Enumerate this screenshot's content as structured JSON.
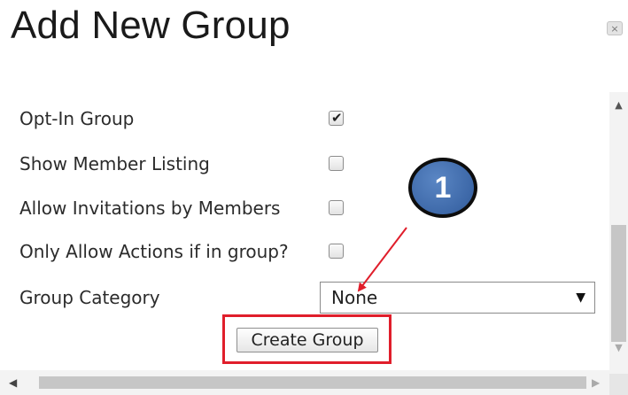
{
  "dialog": {
    "title": "Add New Group",
    "close_icon": "×"
  },
  "form": {
    "rows": [
      {
        "label": "Opt-In Group",
        "checked": true
      },
      {
        "label": "Show Member Listing",
        "checked": false
      },
      {
        "label": "Allow Invitations by Members",
        "checked": false
      },
      {
        "label": "Only Allow Actions if in group?",
        "checked": false
      }
    ],
    "category": {
      "label": "Group Category",
      "selected": "None",
      "arrow": "▼"
    },
    "submit_label": "Create Group"
  },
  "annotation": {
    "step_number": "1",
    "highlight_color": "#e01e2b",
    "badge_color": "#3d68a8"
  },
  "icons": {
    "check": "check-icon",
    "close": "close-icon",
    "scroll_up": "chevron-up-icon",
    "scroll_down": "chevron-down-icon",
    "scroll_left": "chevron-left-icon",
    "scroll_right": "chevron-right-icon"
  }
}
